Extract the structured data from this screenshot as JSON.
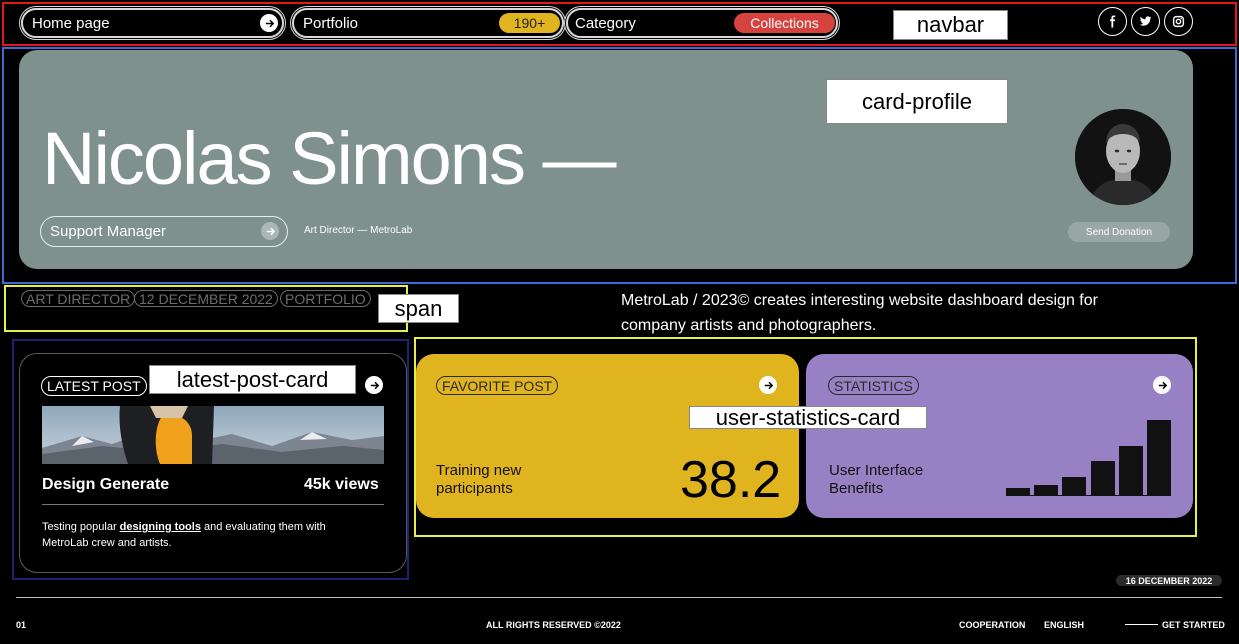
{
  "navbar": {
    "home_label": "Home page",
    "portfolio_label": "Portfolio",
    "portfolio_count": "190+",
    "category_label": "Category",
    "collections_label": "Collections",
    "socials": [
      "facebook-icon",
      "twitter-icon",
      "instagram-icon"
    ],
    "badge_colors": {
      "count": "#e0b41f",
      "collections": "#d6433f"
    }
  },
  "annotations": {
    "navbar": "navbar",
    "card_profile": "card-profile",
    "span": "span",
    "latest_post_card": "latest-post-card",
    "user_statistics_card": "user-statistics-card"
  },
  "profile": {
    "name": "Nicolas Simons —",
    "role": "Support Manager",
    "sub_role": "Art Director — MetroLab",
    "donate_label": "Send Donation",
    "card_color": "#7f918d"
  },
  "tags": [
    "ART DIRECTOR",
    "12 DECEMBER 2022",
    "PORTFOLIO"
  ],
  "description": "MetroLab / 2023© creates interesting website dashboard design for company artists and photographers.",
  "latest_post": {
    "tag": "LATEST POST",
    "title": "Design Generate",
    "views": "45k views",
    "text_before": "Testing popular ",
    "text_link": "designing tools",
    "text_after": " and evaluating them with MetroLab crew and artists."
  },
  "favorite_post": {
    "tag": "FAVORITE POST",
    "label_line1": "Training new",
    "label_line2": "participants",
    "value": "38.2",
    "color": "#e0b41f"
  },
  "statistics": {
    "tag": "STATISTICS",
    "label_line1": "User Interface",
    "label_line2": "Benefits",
    "color": "#9880c5",
    "bar_levels": [
      0.1,
      0.14,
      0.24,
      0.46,
      0.66,
      1.0
    ]
  },
  "footer": {
    "date": "16 DECEMBER 2022",
    "page": "01",
    "rights": "ALL RIGHTS RESERVED ©2022",
    "cooperation": "COOPERATION",
    "language": "ENGLISH",
    "get_started": "GET STARTED"
  }
}
